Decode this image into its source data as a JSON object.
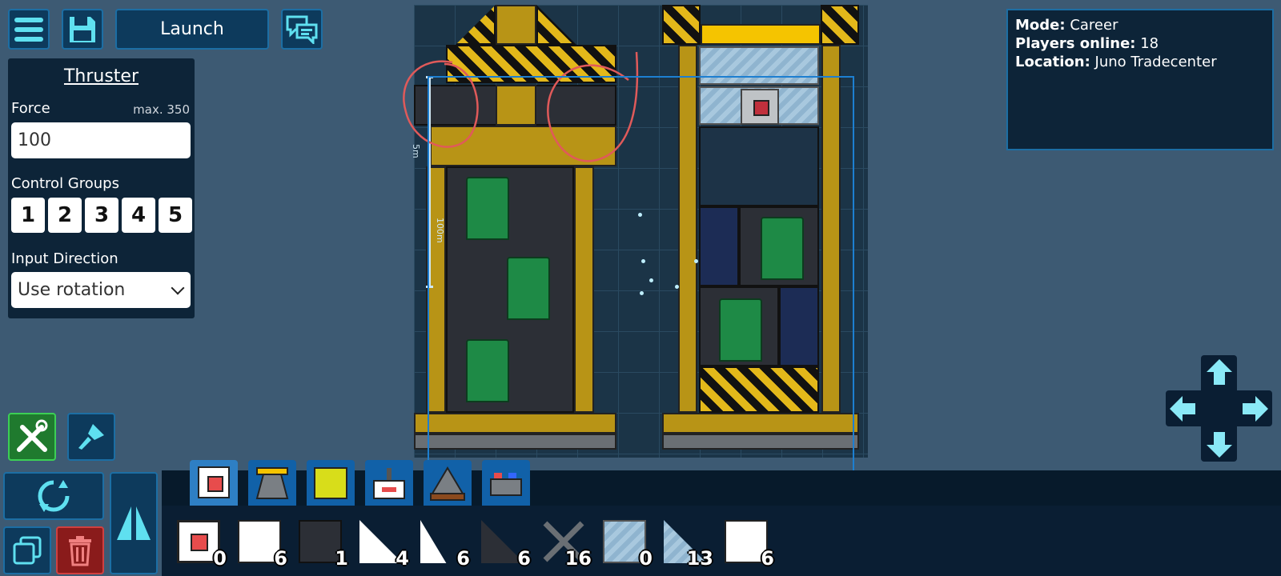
{
  "toolbar": {
    "launch_label": "Launch"
  },
  "panel": {
    "title": "Thruster",
    "force_label": "Force",
    "force_max": "max. 350",
    "force_value": "100",
    "control_groups_label": "Control Groups",
    "control_groups": [
      "1",
      "2",
      "3",
      "4",
      "5"
    ],
    "input_direction_label": "Input Direction",
    "input_direction_value": "Use rotation"
  },
  "info": {
    "mode_label": "Mode:",
    "mode_value": "Career",
    "players_label": "Players online:",
    "players_value": "18",
    "location_label": "Location:",
    "location_value": "Juno Tradecenter"
  },
  "ruler": {
    "small": "5m",
    "large": "100m"
  },
  "inventory": [
    {
      "name": "thruster-part",
      "count": "0"
    },
    {
      "name": "white-block",
      "count": "6"
    },
    {
      "name": "dark-block",
      "count": "1"
    },
    {
      "name": "white-ramp",
      "count": "4"
    },
    {
      "name": "white-small-ramp",
      "count": "6"
    },
    {
      "name": "dark-ramp",
      "count": "6"
    },
    {
      "name": "cross-beam",
      "count": "16"
    },
    {
      "name": "glass-block",
      "count": "0"
    },
    {
      "name": "glass-ramp",
      "count": "13"
    },
    {
      "name": "white-block-2",
      "count": "6"
    }
  ],
  "colors": {
    "accent": "#1c6ea4",
    "background": "#3d5a73",
    "fuel": "#1e8a46",
    "hull": "#b89416",
    "annotation": "#e05a5a"
  }
}
